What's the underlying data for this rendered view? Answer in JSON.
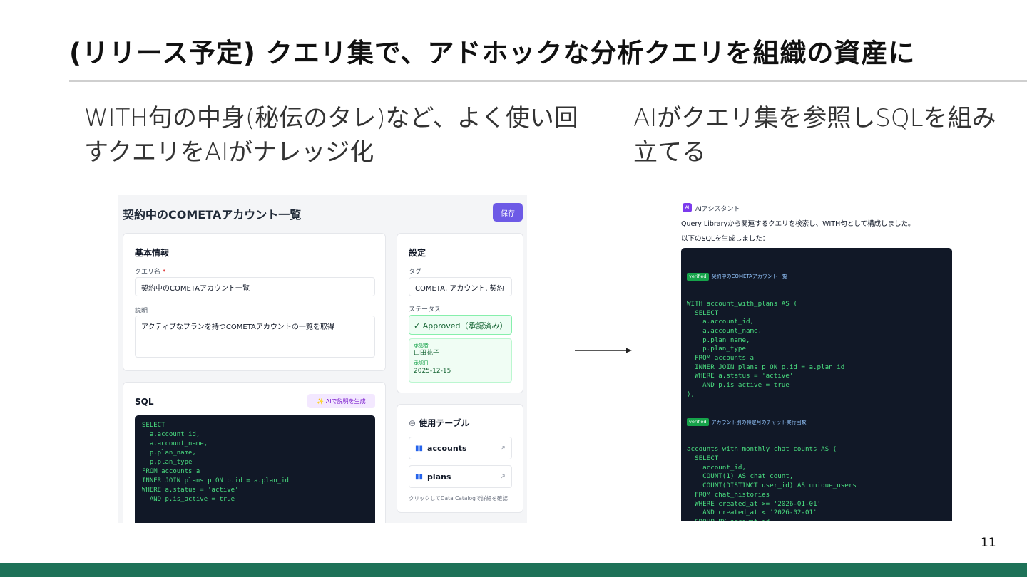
{
  "slide": {
    "title": "(リリース予定) クエリ集で、アドホックな分析クエリを組織の資産に",
    "bullet_left": "WITH句の中身(秘伝のタレ)など、よく使い回すクエリをAIがナレッジ化",
    "bullet_right": "AIがクエリ集を参照しSQLを組み立てる",
    "page_number": "11",
    "footer_color": "#1e7258"
  },
  "query_form": {
    "title": "契約中のCOMETAアカウント一覧",
    "save_label": "保存",
    "basic_info": {
      "heading": "基本情報",
      "name_label": "クエリ名",
      "required_mark": "*",
      "name_value": "契約中のCOMETAアカウント一覧",
      "desc_label": "説明",
      "desc_value": "アクティブなプランを持つCOMETAアカウントの一覧を取得"
    },
    "settings": {
      "heading": "設定",
      "tag_label": "タグ",
      "tag_value": "COMETA, アカウント, 契約",
      "status_label": "ステータス",
      "status_value": "✓ Approved（承認済み）",
      "approver_label": "承認者",
      "approver_value": "山田花子",
      "approved_date_label": "承認日",
      "approved_date_value": "2025-12-15"
    },
    "sql": {
      "heading": "SQL",
      "ai_button_label": "✨ AIで説明を生成",
      "code": "SELECT\n  a.account_id,\n  a.account_name,\n  p.plan_name,\n  p.plan_type\nFROM accounts a\nINNER JOIN plans p ON p.id = a.plan_id\nWHERE a.status = 'active'\n  AND p.is_active = true"
    },
    "tables": {
      "heading": "使用テーブル",
      "items": [
        "accounts",
        "plans"
      ],
      "hint": "クリックしてData Catalogで詳細を確認"
    }
  },
  "ai_chat": {
    "badge": "AI",
    "assistant_name": "AIアシスタント",
    "message_1": "Query Libraryから関連するクエリを検索し、WITH句として構成しました。",
    "message_2": "以下のSQLを生成しました：",
    "verified_label": "verified",
    "block1_title": "契約中のCOMETAアカウント一覧",
    "block1_code": "WITH account_with_plans AS (\n  SELECT\n    a.account_id,\n    a.account_name,\n    p.plan_name,\n    p.plan_type\n  FROM accounts a\n  INNER JOIN plans p ON p.id = a.plan_id\n  WHERE a.status = 'active'\n    AND p.is_active = true\n),",
    "block2_title": "アカウント別の特定月のチャット実行回数",
    "block2_code": "accounts_with_monthly_chat_counts AS (\n  SELECT\n    account_id,\n    COUNT(1) AS chat_count,\n    COUNT(DISTINCT user_id) AS unique_users\n  FROM chat_histories\n  WHERE created_at >= '2026-01-01'\n    AND created_at < '2026-02-01'\n  GROUP BY account_id\n)\nSELECT\n  awp.account_id,\n  awp.account_name,\n  awp.plan_name,\n  COALESCE(amcc.chat_count, 0) AS chat_count,\n  COALESCE(amcc.unique_users, 0) AS unique_users"
  }
}
